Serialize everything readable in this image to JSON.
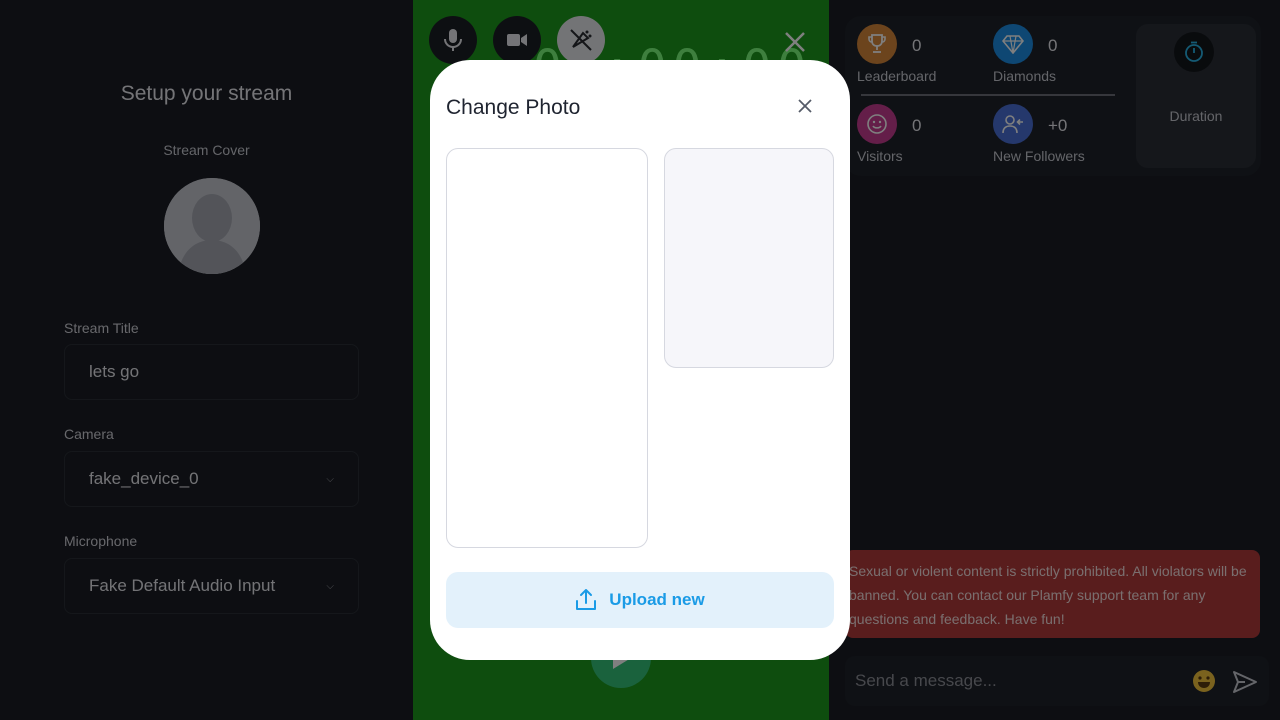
{
  "setup": {
    "title": "Setup your stream",
    "cover_label": "Stream Cover",
    "stream_title_label": "Stream Title",
    "stream_title_value": "lets go",
    "camera_label": "Camera",
    "camera_value": "fake_device_0",
    "microphone_label": "Microphone",
    "microphone_value": "Fake Default Audio Input"
  },
  "controls": {
    "icons": [
      "microphone-icon",
      "camera-icon",
      "effects-off-icon",
      "close-icon",
      "play-icon"
    ],
    "timer": "00:00:00"
  },
  "stats": {
    "leaderboard": {
      "value": "0",
      "label": "Leaderboard",
      "color": "#d9893a"
    },
    "diamonds": {
      "value": "0",
      "label": "Diamonds",
      "color": "#1d8fe6"
    },
    "visitors": {
      "value": "0",
      "label": "Visitors",
      "color": "#c83d93"
    },
    "new_followers": {
      "value": "+0",
      "label": "New Followers",
      "color": "#4a70d8"
    },
    "duration": {
      "label": "Duration",
      "color": "#29b4e8"
    }
  },
  "notice": "Sexual or violent content is strictly prohibited. All violators will be banned. You can contact our Plamfy support team for any questions and feedback. Have fun!",
  "chat": {
    "placeholder": "Send a message..."
  },
  "modal": {
    "title": "Change Photo",
    "upload_label": "Upload new",
    "accent": "#1a9be6"
  }
}
